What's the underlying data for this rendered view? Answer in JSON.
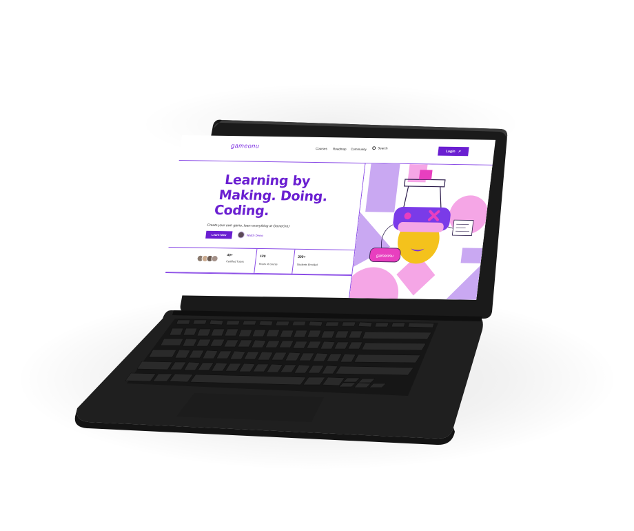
{
  "site": {
    "logo": "gameonu",
    "nav": {
      "courses": "Courses",
      "roadmap": "Roadmap",
      "community": "Community",
      "search": "Search",
      "login": "Login"
    },
    "hero": {
      "headline": [
        "Learning by",
        "Making. Doing.",
        "Coding."
      ],
      "subtext": "Create your own game, learn everything at GameOnU",
      "cta_primary": "Learn Now",
      "cta_secondary": "Watch Demo"
    },
    "stats": [
      {
        "value": "40+",
        "label": "Certified Tutors"
      },
      {
        "value": "120",
        "label": "Hours of course"
      },
      {
        "value": "300+",
        "label": "Students Enrolled"
      }
    ],
    "illustration": {
      "controller_label": "gameonu"
    }
  },
  "colors": {
    "brand": "#6a1fd1",
    "accent_pink": "#f5a6e6",
    "accent_lilac": "#c9a8f2",
    "face_yellow": "#f4c21c",
    "laptop_body": "#1e1e1e"
  }
}
